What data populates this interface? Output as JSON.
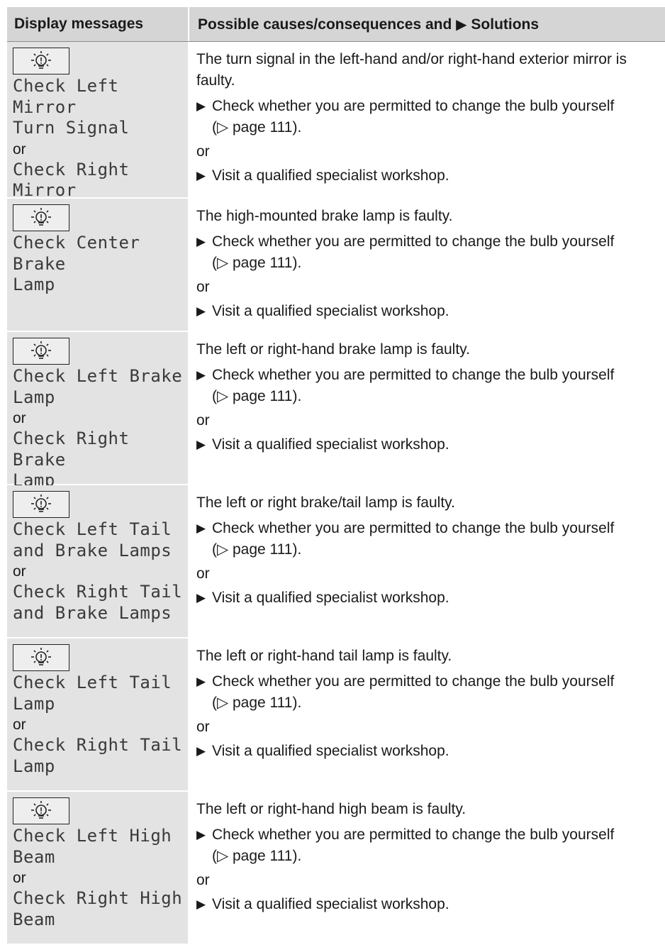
{
  "header": {
    "col1": "Display messages",
    "col2_prefix": "Possible causes/consequences and",
    "col2_arrow": "▶",
    "col2_suffix": "Solutions"
  },
  "icons": {
    "lamp": "lamp-warning-icon",
    "bullet": "triangle-bullet-icon",
    "pageref": "page-reference-triangle-icon"
  },
  "rows": [
    {
      "messages": [
        "Check Left Mirror\nTurn Signal",
        "or",
        "Check Right Mirror\nTurn Signal"
      ],
      "cause": "The turn signal in the left-hand and/or right-hand exterior mirror is faulty.",
      "step1": "Check whether you are permitted to change the bulb yourself",
      "ref": "(▷ page 111).",
      "or": "or",
      "step2": "Visit a qualified specialist workshop."
    },
    {
      "messages": [
        "Check Center Brake\nLamp"
      ],
      "cause": "The high-mounted brake lamp is faulty.",
      "step1": "Check whether you are permitted to change the bulb yourself",
      "ref": "(▷ page 111).",
      "or": "or",
      "step2": "Visit a qualified specialist workshop."
    },
    {
      "messages": [
        "Check Left Brake\nLamp",
        "or",
        "Check Right Brake\nLamp"
      ],
      "cause": "The left or right-hand brake lamp is faulty.",
      "step1": "Check whether you are permitted to change the bulb yourself",
      "ref": "(▷ page 111).",
      "or": "or",
      "step2": "Visit a qualified specialist workshop."
    },
    {
      "messages": [
        "Check Left Tail\nand Brake Lamps",
        "or",
        "Check Right Tail\nand Brake Lamps"
      ],
      "cause": "The left or right brake/tail lamp is faulty.",
      "step1": "Check whether you are permitted to change the bulb yourself",
      "ref": "(▷ page 111).",
      "or": "or",
      "step2": "Visit a qualified specialist workshop."
    },
    {
      "messages": [
        "Check Left Tail\nLamp",
        "or",
        "Check Right Tail\nLamp"
      ],
      "cause": "The left or right-hand tail lamp is faulty.",
      "step1": "Check whether you are permitted to change the bulb yourself",
      "ref": "(▷ page 111).",
      "or": "or",
      "step2": "Visit a qualified specialist workshop."
    },
    {
      "messages": [
        "Check Left High\nBeam",
        "or",
        "Check Right High\nBeam"
      ],
      "cause": "The left or right-hand high beam is faulty.",
      "step1": "Check whether you are permitted to change the bulb yourself",
      "ref": "(▷ page 111).",
      "or": "or",
      "step2": "Visit a qualified specialist workshop."
    }
  ]
}
